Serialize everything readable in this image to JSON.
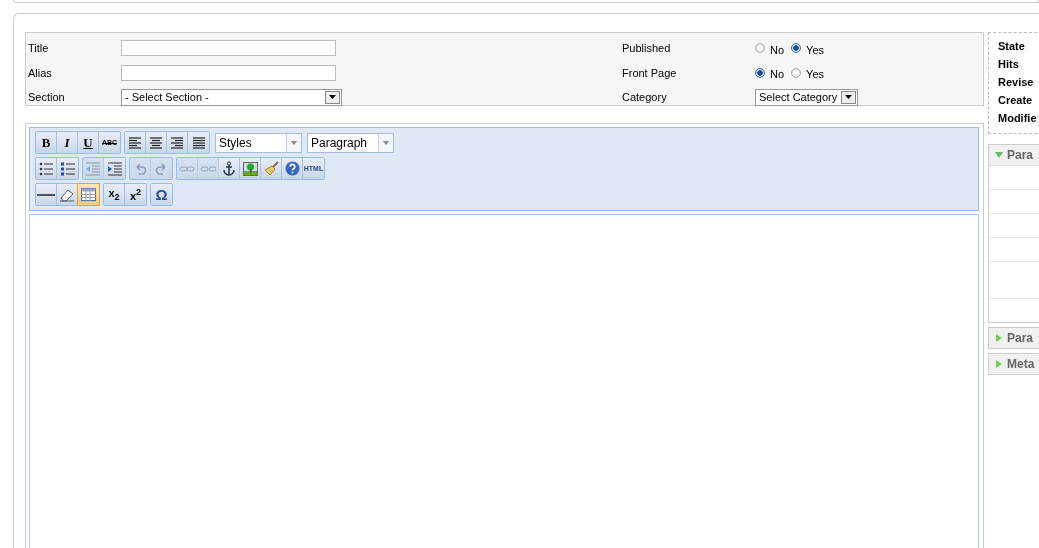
{
  "form_left": [
    {
      "label": "Title",
      "kind": "text"
    },
    {
      "label": "Alias",
      "kind": "text"
    },
    {
      "label": "Section",
      "kind": "select",
      "value": "- Select Section -"
    }
  ],
  "form_right": [
    {
      "label": "Published",
      "kind": "radio",
      "options": [
        {
          "label": "No",
          "selected": false
        },
        {
          "label": "Yes",
          "selected": true
        }
      ]
    },
    {
      "label": "Front Page",
      "kind": "radio",
      "options": [
        {
          "label": "No",
          "selected": true
        },
        {
          "label": "Yes",
          "selected": false
        }
      ]
    },
    {
      "label": "Category",
      "kind": "select",
      "value": "Select Category"
    }
  ],
  "toolbar": [
    [
      {
        "kind": "buttons",
        "buttons": [
          {
            "kind": "bold",
            "label": "B",
            "disabled": false,
            "selected": false
          },
          {
            "kind": "italic",
            "label": "I",
            "disabled": false,
            "selected": false
          },
          {
            "kind": "underline",
            "label": "U",
            "disabled": false,
            "selected": false
          },
          {
            "kind": "strike",
            "label": "ABC",
            "disabled": false,
            "selected": false
          }
        ]
      },
      {
        "kind": "buttons",
        "buttons": [
          {
            "kind": "align-left",
            "disabled": false,
            "selected": false
          },
          {
            "kind": "align-center",
            "disabled": false,
            "selected": false
          },
          {
            "kind": "align-right",
            "disabled": false,
            "selected": false
          },
          {
            "kind": "align-justify",
            "disabled": false,
            "selected": false
          }
        ]
      },
      {
        "kind": "dropdown",
        "value": "Styles"
      },
      {
        "kind": "dropdown",
        "value": "Paragraph"
      }
    ],
    [
      {
        "kind": "buttons",
        "buttons": [
          {
            "kind": "bullets",
            "disabled": false,
            "selected": false
          },
          {
            "kind": "numbers",
            "disabled": false,
            "selected": false
          }
        ]
      },
      {
        "kind": "buttons",
        "buttons": [
          {
            "kind": "outdent",
            "disabled": true,
            "selected": false
          },
          {
            "kind": "indent",
            "disabled": false,
            "selected": false
          }
        ]
      },
      {
        "kind": "buttons",
        "buttons": [
          {
            "kind": "undo",
            "disabled": true,
            "selected": false
          },
          {
            "kind": "redo",
            "disabled": true,
            "selected": false
          }
        ]
      },
      {
        "kind": "buttons",
        "buttons": [
          {
            "kind": "link",
            "disabled": true,
            "selected": false
          },
          {
            "kind": "unlink",
            "disabled": true,
            "selected": false
          },
          {
            "kind": "anchor",
            "disabled": false,
            "selected": false
          },
          {
            "kind": "image",
            "disabled": false,
            "selected": false
          },
          {
            "kind": "cleanup",
            "disabled": false,
            "selected": false
          },
          {
            "kind": "help",
            "disabled": false,
            "selected": false
          },
          {
            "kind": "html",
            "label": "HTML",
            "disabled": false,
            "selected": false
          }
        ]
      }
    ],
    [
      {
        "kind": "buttons",
        "buttons": [
          {
            "kind": "rule",
            "disabled": false,
            "selected": false
          },
          {
            "kind": "eraser",
            "disabled": false,
            "selected": false
          },
          {
            "kind": "table",
            "disabled": false,
            "selected": true
          }
        ]
      },
      {
        "kind": "buttons",
        "buttons": [
          {
            "kind": "subscript",
            "label": "x$_{2}$",
            "disabled": false,
            "selected": false
          },
          {
            "kind": "superscript",
            "label": "x$^{2}$",
            "disabled": false,
            "selected": false
          }
        ]
      },
      {
        "kind": "buttons",
        "buttons": [
          {
            "kind": "charmap",
            "label": "Ω",
            "disabled": false,
            "selected": false
          }
        ]
      }
    ]
  ],
  "details": [
    "State",
    "Hits",
    "Revise",
    "Create",
    "Modifie"
  ],
  "panels": [
    {
      "title": "Para",
      "expanded": true
    },
    {
      "title": "Para",
      "expanded": false
    },
    {
      "title": "Meta",
      "expanded": false
    }
  ]
}
